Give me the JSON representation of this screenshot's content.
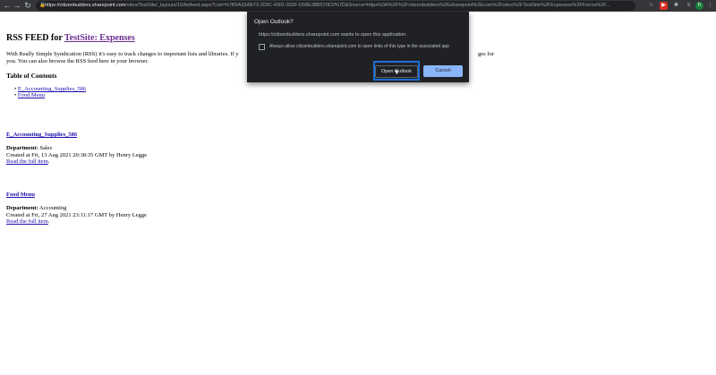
{
  "browser": {
    "url_host": "https://citizenbuilders.sharepoint.com",
    "url_path": "/sites/TestSite/_layouts/15/listfeed.aspx?List=%7B9A32AB73-203C-4301-932F-D58E38B570D2%7D&Source=https%3A%2F%2Fcitizenbuilders%2Esharepoint%2Ecom%2Fsites%2FTestSite%2FExpenses%2FForms%2F...",
    "avatar_letter": "h"
  },
  "page": {
    "heading_prefix": "RSS FEED for ",
    "heading_link": "TestSite: Expenses",
    "intro_visible_start": "With Really Simple Syndication (RSS) it's easy to track changes to important lists and libraries. If y",
    "intro_visible_end": "ges for",
    "intro_line2": "you. You can also browse the RSS feed here in your browser.",
    "toc_title": "Table of Contents",
    "toc_items": [
      "E_Accounting_Supplies_586",
      "Food Menu"
    ]
  },
  "items": [
    {
      "title": "E_Accounting_Supplies_586",
      "dept_label": "Department:",
      "dept_value": " Sales",
      "created": "Created at Fri, 13 Aug 2021 20:38:35 GMT by Henry Legge",
      "read_more": "Read the full item",
      "period": "."
    },
    {
      "title": "Food Menu",
      "dept_label": "Department:",
      "dept_value": " Accounting",
      "created": "Created at Fri, 27 Aug 2021 23:11:17 GMT by Henry Legge",
      "read_more": "Read the full item",
      "period": "."
    }
  ],
  "dialog": {
    "title": "Open Outlook?",
    "message": "https://citizenbuilders.sharepoint.com wants to open this application.",
    "checkbox_label": "Always allow citizenbuilders.sharepoint.com to open links of this type in the associated app",
    "open_label": "Open Outlook",
    "cancel_label": "Cancel"
  }
}
